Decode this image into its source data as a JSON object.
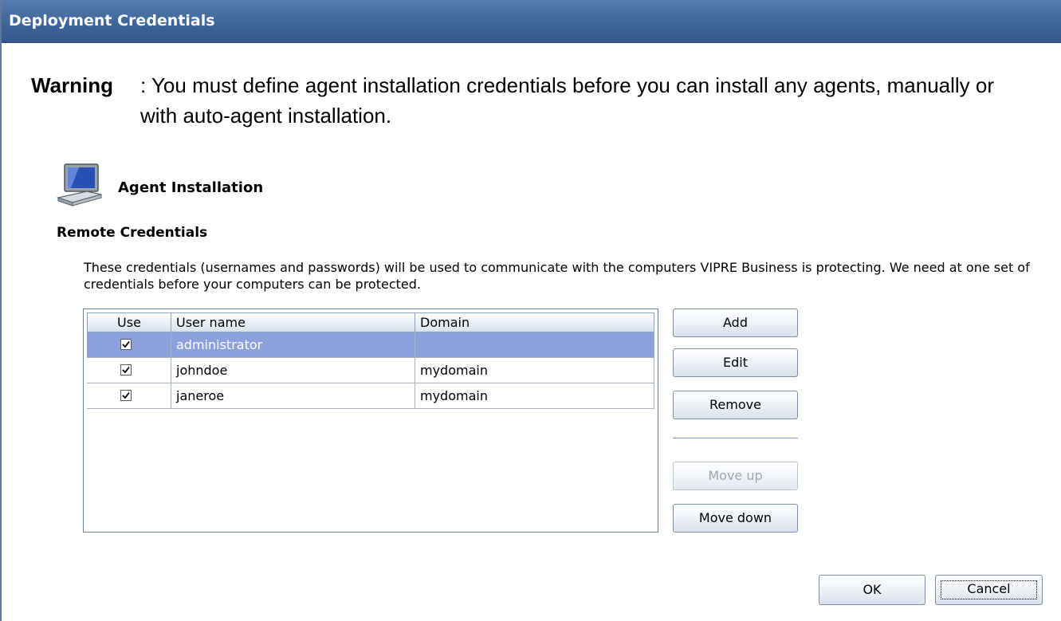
{
  "window": {
    "title": "Deployment Credentials"
  },
  "warning": {
    "label": "Warning",
    "text": ": You must define agent installation credentials before you can install any agents, manually or with auto-agent installation."
  },
  "section": {
    "icon": "computer-monitor-icon",
    "title": "Agent Installation"
  },
  "remote": {
    "title": "Remote Credentials",
    "description": "These credentials (usernames and passwords) will be used to communicate with the computers VIPRE Business is protecting. We need at one set of credentials before your computers can be protected."
  },
  "grid": {
    "columns": [
      "Use",
      "User name",
      "Domain"
    ],
    "rows": [
      {
        "use": true,
        "username": "administrator",
        "domain": "",
        "selected": true
      },
      {
        "use": true,
        "username": "johndoe",
        "domain": "mydomain",
        "selected": false
      },
      {
        "use": true,
        "username": "janeroe",
        "domain": "mydomain",
        "selected": false
      }
    ]
  },
  "buttons": {
    "add": "Add",
    "edit": "Edit",
    "remove": "Remove",
    "move_up": "Move up",
    "move_down": "Move down",
    "ok": "OK",
    "cancel": "Cancel"
  },
  "colors": {
    "titlebar": "#3f6698",
    "selection": "#8ca0dc"
  }
}
